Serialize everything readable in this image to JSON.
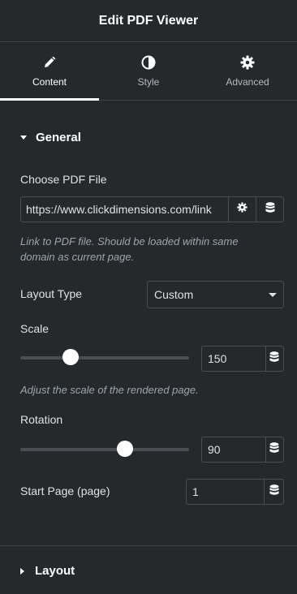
{
  "header": {
    "title": "Edit PDF Viewer"
  },
  "tabs": [
    {
      "label": "Content",
      "icon": "pencil-icon",
      "active": true
    },
    {
      "label": "Style",
      "icon": "contrast-icon",
      "active": false
    },
    {
      "label": "Advanced",
      "icon": "gear-icon",
      "active": false
    }
  ],
  "general": {
    "title": "General",
    "pdf_file": {
      "label": "Choose PDF File",
      "value": "https://www.clickdimensions.com/link",
      "help": "Link to PDF file. Should be loaded within same domain as current page."
    },
    "layout_type": {
      "label": "Layout Type",
      "value": "Custom"
    },
    "scale": {
      "label": "Scale",
      "value": "150",
      "slider_fraction": 0.3,
      "help": "Adjust the scale of the rendered page."
    },
    "rotation": {
      "label": "Rotation",
      "value": "90",
      "slider_fraction": 0.62
    },
    "start_page": {
      "label": "Start Page (page)",
      "value": "1"
    }
  },
  "layout_section": {
    "title": "Layout"
  },
  "colors": {
    "background": "#26292c",
    "border": "#4a4d52",
    "help_text": "#9da5ae"
  }
}
